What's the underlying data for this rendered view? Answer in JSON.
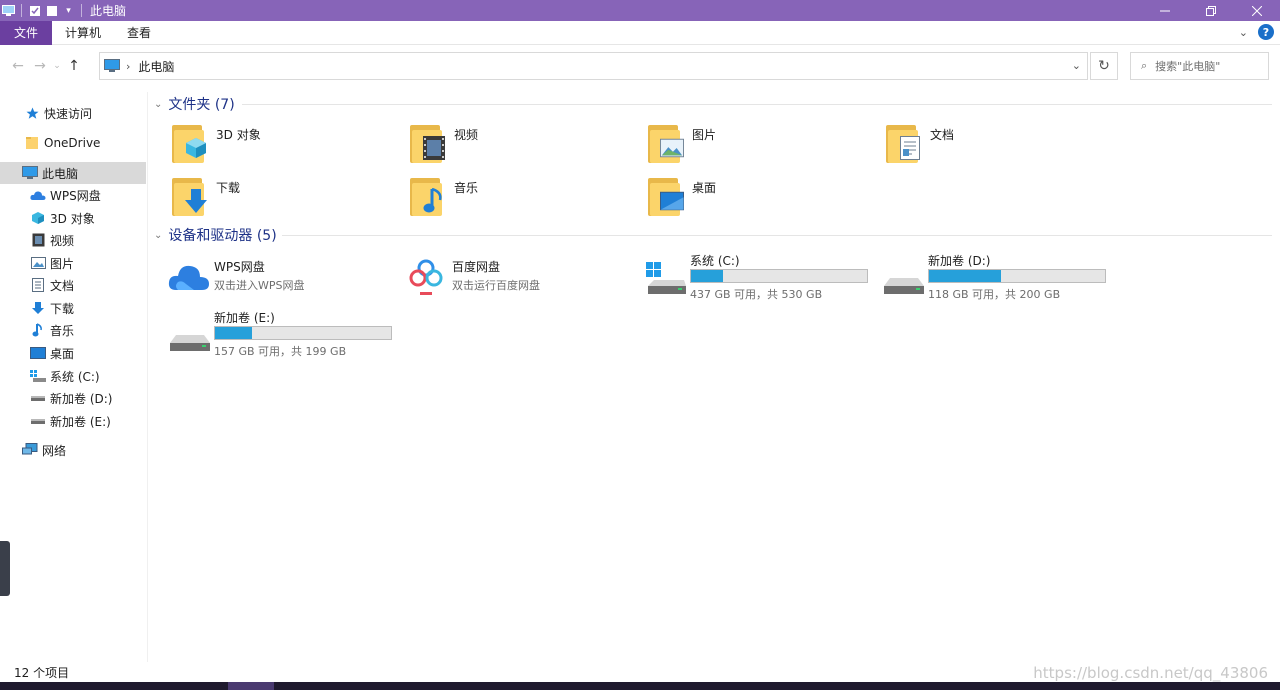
{
  "window": {
    "title": "此电脑"
  },
  "ribbon": {
    "tabs": [
      "文件",
      "计算机",
      "查看"
    ]
  },
  "address": {
    "crumb": "此电脑"
  },
  "search": {
    "placeholder": "搜索\"此电脑\""
  },
  "sidebar": {
    "items": [
      {
        "label": "快速访问",
        "icon": "star-icon"
      },
      {
        "label": "OneDrive",
        "icon": "folder-icon"
      },
      {
        "label": "此电脑",
        "icon": "computer-icon",
        "selected": true
      },
      {
        "label": "WPS网盘",
        "icon": "cloud-icon"
      },
      {
        "label": "3D 对象",
        "icon": "cube-icon"
      },
      {
        "label": "视频",
        "icon": "video-icon"
      },
      {
        "label": "图片",
        "icon": "picture-icon"
      },
      {
        "label": "文档",
        "icon": "document-icon"
      },
      {
        "label": "下载",
        "icon": "download-icon"
      },
      {
        "label": "音乐",
        "icon": "music-icon"
      },
      {
        "label": "桌面",
        "icon": "desktop-icon"
      },
      {
        "label": "系统 (C:)",
        "icon": "system-drive-icon"
      },
      {
        "label": "新加卷 (D:)",
        "icon": "drive-icon"
      },
      {
        "label": "新加卷 (E:)",
        "icon": "drive-icon"
      },
      {
        "label": "网络",
        "icon": "network-icon"
      }
    ]
  },
  "groups": {
    "folders": {
      "header": "文件夹 (7)"
    },
    "devices": {
      "header": "设备和驱动器 (5)"
    }
  },
  "folders": [
    {
      "label": "3D 对象",
      "icon": "cube-icon"
    },
    {
      "label": "视频",
      "icon": "video-icon"
    },
    {
      "label": "图片",
      "icon": "picture-icon"
    },
    {
      "label": "文档",
      "icon": "document-icon"
    },
    {
      "label": "下载",
      "icon": "download-icon"
    },
    {
      "label": "音乐",
      "icon": "music-icon"
    },
    {
      "label": "桌面",
      "icon": "desktop-icon"
    }
  ],
  "devices": {
    "wps": {
      "label": "WPS网盘",
      "sub": "双击进入WPS网盘"
    },
    "baidu": {
      "label": "百度网盘",
      "sub": "双击运行百度网盘"
    },
    "drives": [
      {
        "label": "系统 (C:)",
        "free": "437 GB 可用，共 530 GB",
        "used_fraction": 0.18
      },
      {
        "label": "新加卷 (D:)",
        "free": "118 GB 可用，共 200 GB",
        "used_fraction": 0.41
      },
      {
        "label": "新加卷 (E:)",
        "free": "157 GB 可用，共 199 GB",
        "used_fraction": 0.21
      }
    ]
  },
  "status": {
    "count": "12 个项目"
  },
  "watermark": "https://blog.csdn.net/qq_43806",
  "colors": {
    "titlebar": "#8764b8",
    "file_tab": "#6b3fa0",
    "group_header": "#1e3287",
    "drive_bar": "#26a0da"
  }
}
